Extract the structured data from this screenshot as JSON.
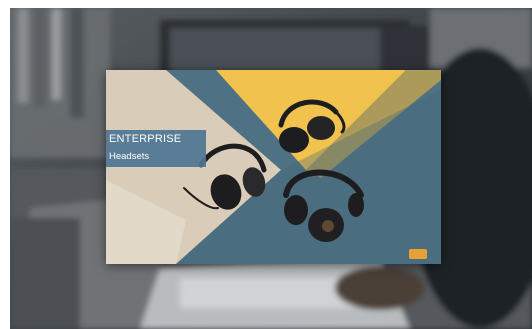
{
  "hero": {
    "title": "ENTERPRISE",
    "subtitle": "Headsets"
  },
  "colors": {
    "page_background": "#ffffff",
    "backdrop_dark": "#3d4247",
    "panel_blue": "#4f7184",
    "panel_yellow": "#f2c24f",
    "panel_beige": "#d9cdb9",
    "label_blue": "#4e7692",
    "logo_orange": "#e7a235",
    "headset_black": "#1d1d1f"
  },
  "icons": {
    "logo": "brand-logo-icon"
  }
}
